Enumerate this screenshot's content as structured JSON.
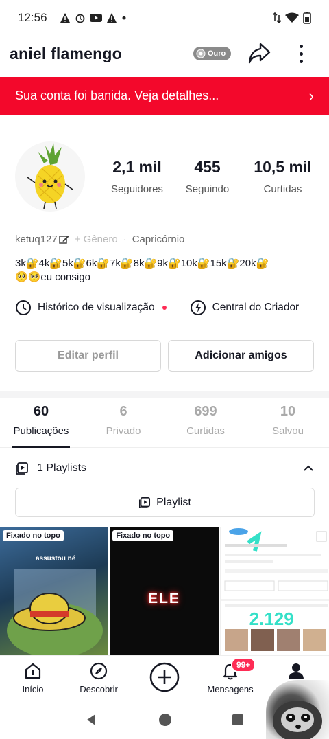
{
  "status_bar": {
    "time": "12:56"
  },
  "header": {
    "username": "aniel flamengo",
    "badge_label": "Ouro"
  },
  "banner": {
    "text": "Sua conta foi banida. Veja detalhes..."
  },
  "stats": [
    {
      "value": "2,1 mil",
      "label": "Seguidores"
    },
    {
      "value": "455",
      "label": "Seguindo"
    },
    {
      "value": "10,5 mil",
      "label": "Curtidas"
    }
  ],
  "profile": {
    "handle": "ketuq127",
    "gender_placeholder": "+ Gênero",
    "dot": "·",
    "zodiac": "Capricórnio",
    "bio_line1": "3k🔐4k🔐5k🔐6k🔐7k🔐8k🔐9k🔐10k🔐15k🔐20k🔐",
    "bio_line2": "🥺🥺eu consigo"
  },
  "links": {
    "history": "Histórico de visualização",
    "creator": "Central do Criador"
  },
  "buttons": {
    "edit": "Editar perfil",
    "add_friends": "Adicionar amigos"
  },
  "tabs": [
    {
      "num": "60",
      "label": "Publicações",
      "active": true
    },
    {
      "num": "6",
      "label": "Privado"
    },
    {
      "num": "699",
      "label": "Curtidas"
    },
    {
      "num": "10",
      "label": "Salvou"
    }
  ],
  "playlists": {
    "header": "1 Playlists",
    "button": "Playlist"
  },
  "grid": [
    {
      "pin": "Fixado no topo",
      "caption": "assustou né"
    },
    {
      "pin": "Fixado no topo",
      "caption": "ELE"
    },
    {
      "overlay_count": "2.129"
    }
  ],
  "nav": {
    "home": "Início",
    "discover": "Descobrir",
    "messages": "Mensagens",
    "messages_badge": "99+"
  }
}
